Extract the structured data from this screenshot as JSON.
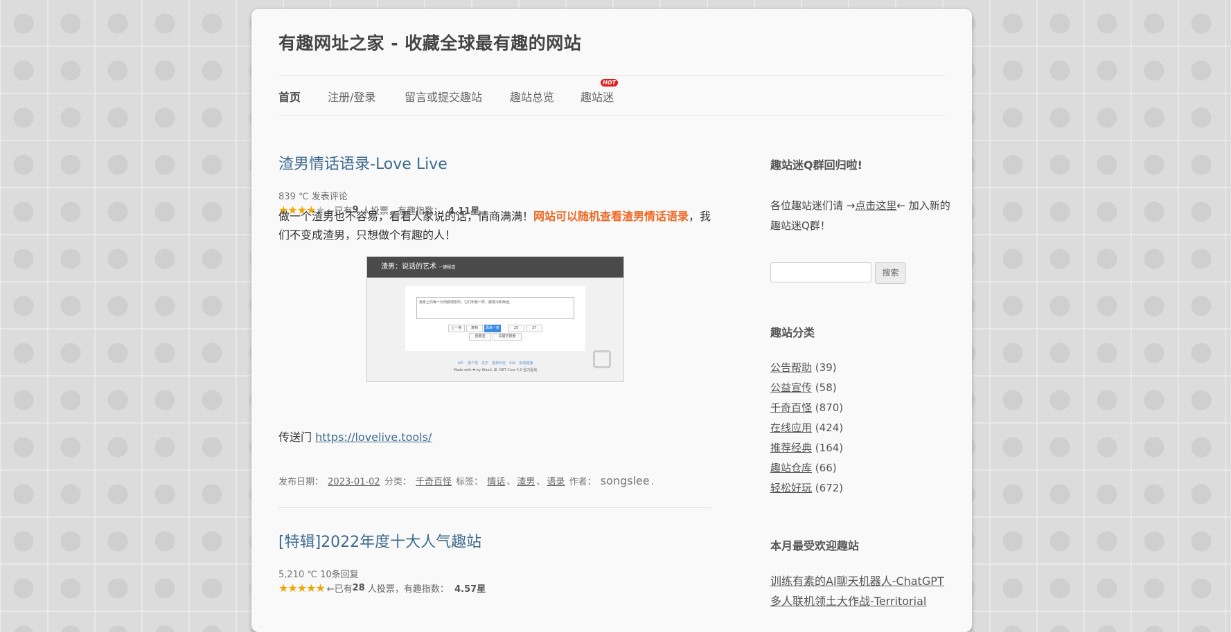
{
  "site": {
    "title": "有趣网址之家 - 收藏全球最有趣的网站"
  },
  "nav": {
    "items": [
      {
        "label": "首页"
      },
      {
        "label": "注册/登录"
      },
      {
        "label": "留言或提交趣站"
      },
      {
        "label": "趣站总览"
      },
      {
        "label": "趣站迷"
      }
    ],
    "hot_badge": "HOT"
  },
  "posts": [
    {
      "title": "渣男情话语录-Love Live",
      "views": "839 ℃",
      "comment_link": "发表评论",
      "votes_prefix": "←已有",
      "votes": "9",
      "votes_suffix": "人投票，有趣指数：",
      "score": "4.11星",
      "excerpt_a": "做一个渣男也不容易，看看人家说的话，情商满满！",
      "excerpt_highlight": "网站可以随机查看渣男情话语录",
      "excerpt_b": "，我们不变成渣男，只想做个有趣的人！",
      "screenshot": {
        "header": "渣男：说话的艺术",
        "header_tag": "一键报道",
        "box_text": "我身上的每一片肉都很想你，它们和我一样，都很污和痴迷。",
        "buttons": [
          "上一条",
          "复制",
          "再来一条",
          "25",
          "37"
        ],
        "buttons2": [
          "我要渣",
          "关键字搜索"
        ],
        "footer_links": "API　 捐个赞　关于　更新日志　SLS　友情链接",
        "footer_text": "Made with ❤ by Wood. 由 .NET Core 3.0 强力驱动"
      },
      "portal_label": "传送门",
      "portal_link": "https://lovelive.tools/",
      "footer": {
        "date_label": "发布日期：",
        "date": "2023-01-02",
        "category_label": "分类：",
        "category": "千奇百怪",
        "tags_label": "标签：",
        "tags": [
          "情话",
          "渣男",
          "语录"
        ],
        "author_label": "作者：",
        "author": "songslee"
      }
    },
    {
      "title": "[特辑]2022年度十大人气趣站",
      "views": "5,210 ℃",
      "comment_link": "10条回复",
      "votes_prefix": "←已有",
      "votes": "28",
      "votes_suffix": "人投票，有趣指数：",
      "score": "4.57星"
    }
  ],
  "sidebar": {
    "qgroup": {
      "title": "趣站迷Q群回归啦!",
      "text_a": "各位趣站迷们请 →",
      "link": "点击这里",
      "text_b": "← 加入新的趣站迷Q群！"
    },
    "search": {
      "button_label": "搜索",
      "placeholder": ""
    },
    "categories": {
      "title": "趣站分类",
      "items": [
        {
          "label": "公告帮助",
          "count": "(39)"
        },
        {
          "label": "公益宣传",
          "count": "(58)"
        },
        {
          "label": "千奇百怪",
          "count": "(870)"
        },
        {
          "label": "在线应用",
          "count": "(424)"
        },
        {
          "label": "推荐经典",
          "count": "(164)"
        },
        {
          "label": "趣站仓库",
          "count": "(66)"
        },
        {
          "label": "轻松好玩",
          "count": "(672)"
        }
      ]
    },
    "popular": {
      "title": "本月最受欢迎趣站",
      "items": [
        {
          "label": "训练有素的AI聊天机器人-ChatGPT"
        },
        {
          "label": "多人联机领土大作战-Territorial"
        }
      ]
    }
  },
  "colors": {
    "link": "#3d6b8e",
    "highlight": "#f26722",
    "hot": "#e21b1b",
    "star": "#f0a500"
  }
}
